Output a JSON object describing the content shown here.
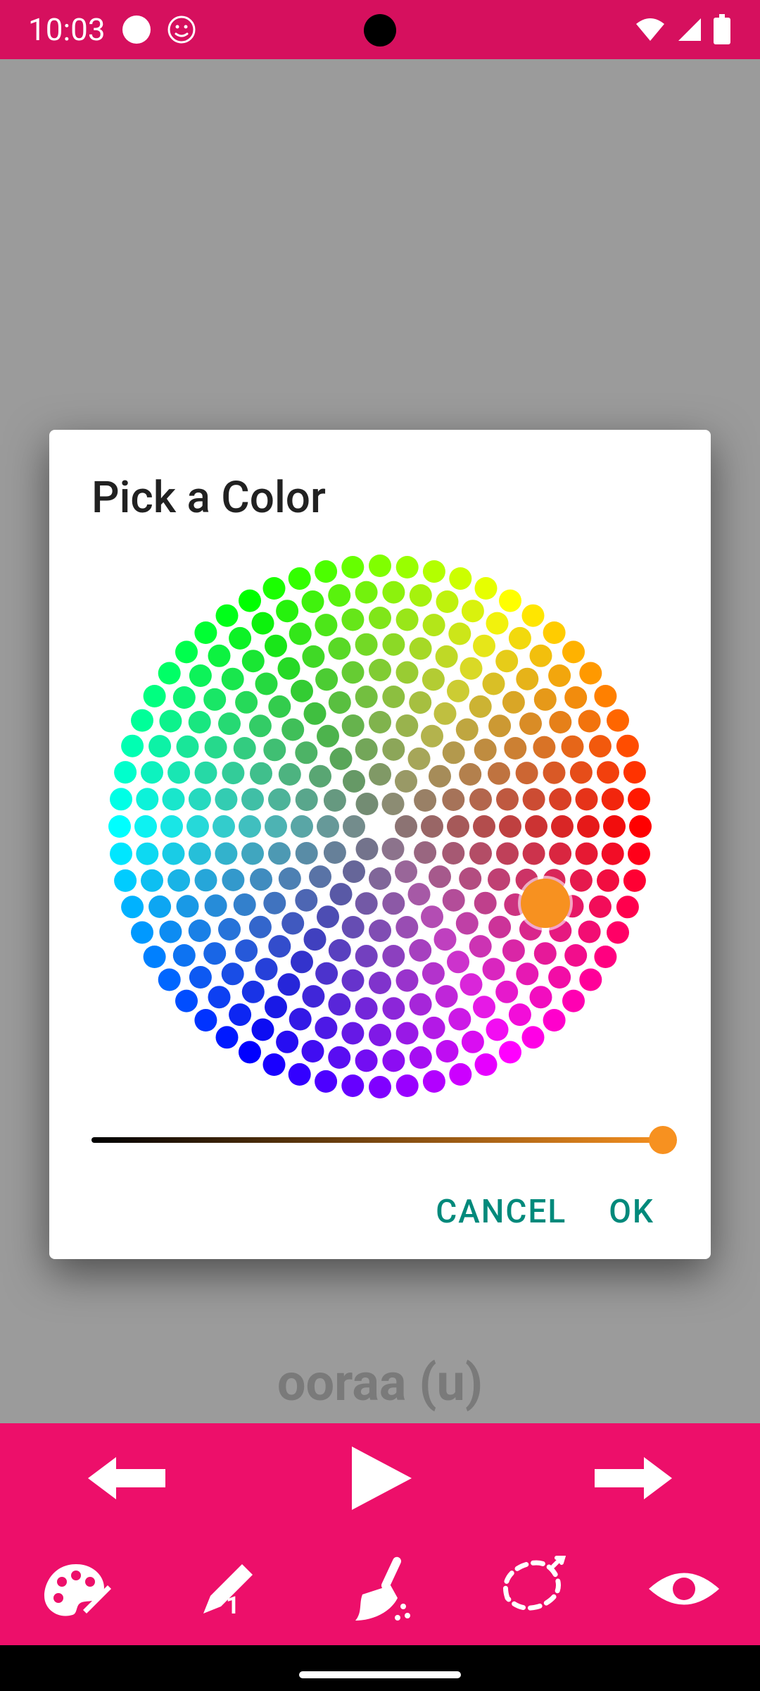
{
  "statusbar": {
    "time": "10:03",
    "icons_left": [
      "notification-dot",
      "notification-face"
    ],
    "icons_right": [
      "wifi",
      "cell-signal",
      "battery"
    ]
  },
  "canvas": {
    "word_label": "ooraa (u)"
  },
  "playback": {
    "prev": "Previous",
    "play": "Play",
    "next": "Next"
  },
  "tools": {
    "palette": "Color palette",
    "pencil": "Pencil size 1",
    "brush": "Clear / sweep",
    "lasso": "Select / lasso",
    "eye": "Preview / visibility"
  },
  "dialog": {
    "title": "Pick a Color",
    "cancel_label": "CANCEL",
    "ok_label": "OK",
    "selected_color": "#f79120",
    "brightness_value": 1.0,
    "wheel": {
      "rings": 10,
      "dots_per_ring_mult": 4,
      "selector_angle_deg": 25,
      "selector_ring": 7
    }
  },
  "colors": {
    "accent": "#ed0f6a",
    "statusbar": "#d6105e",
    "dialog_action": "#00897b"
  }
}
